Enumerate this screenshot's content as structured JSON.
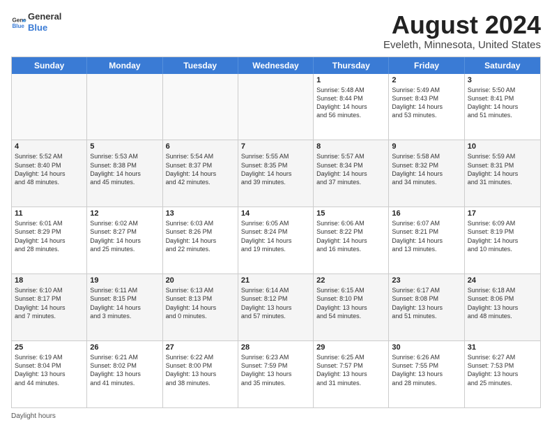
{
  "header": {
    "logo_line1": "General",
    "logo_line2": "Blue",
    "main_title": "August 2024",
    "subtitle": "Eveleth, Minnesota, United States"
  },
  "days_of_week": [
    "Sunday",
    "Monday",
    "Tuesday",
    "Wednesday",
    "Thursday",
    "Friday",
    "Saturday"
  ],
  "footer_text": "Daylight hours",
  "rows": [
    [
      {
        "day": "",
        "info": "",
        "empty": true
      },
      {
        "day": "",
        "info": "",
        "empty": true
      },
      {
        "day": "",
        "info": "",
        "empty": true
      },
      {
        "day": "",
        "info": "",
        "empty": true
      },
      {
        "day": "1",
        "info": "Sunrise: 5:48 AM\nSunset: 8:44 PM\nDaylight: 14 hours\nand 56 minutes.",
        "empty": false
      },
      {
        "day": "2",
        "info": "Sunrise: 5:49 AM\nSunset: 8:43 PM\nDaylight: 14 hours\nand 53 minutes.",
        "empty": false
      },
      {
        "day": "3",
        "info": "Sunrise: 5:50 AM\nSunset: 8:41 PM\nDaylight: 14 hours\nand 51 minutes.",
        "empty": false
      }
    ],
    [
      {
        "day": "4",
        "info": "Sunrise: 5:52 AM\nSunset: 8:40 PM\nDaylight: 14 hours\nand 48 minutes.",
        "empty": false,
        "alt": true
      },
      {
        "day": "5",
        "info": "Sunrise: 5:53 AM\nSunset: 8:38 PM\nDaylight: 14 hours\nand 45 minutes.",
        "empty": false,
        "alt": true
      },
      {
        "day": "6",
        "info": "Sunrise: 5:54 AM\nSunset: 8:37 PM\nDaylight: 14 hours\nand 42 minutes.",
        "empty": false,
        "alt": true
      },
      {
        "day": "7",
        "info": "Sunrise: 5:55 AM\nSunset: 8:35 PM\nDaylight: 14 hours\nand 39 minutes.",
        "empty": false,
        "alt": true
      },
      {
        "day": "8",
        "info": "Sunrise: 5:57 AM\nSunset: 8:34 PM\nDaylight: 14 hours\nand 37 minutes.",
        "empty": false,
        "alt": true
      },
      {
        "day": "9",
        "info": "Sunrise: 5:58 AM\nSunset: 8:32 PM\nDaylight: 14 hours\nand 34 minutes.",
        "empty": false,
        "alt": true
      },
      {
        "day": "10",
        "info": "Sunrise: 5:59 AM\nSunset: 8:31 PM\nDaylight: 14 hours\nand 31 minutes.",
        "empty": false,
        "alt": true
      }
    ],
    [
      {
        "day": "11",
        "info": "Sunrise: 6:01 AM\nSunset: 8:29 PM\nDaylight: 14 hours\nand 28 minutes.",
        "empty": false
      },
      {
        "day": "12",
        "info": "Sunrise: 6:02 AM\nSunset: 8:27 PM\nDaylight: 14 hours\nand 25 minutes.",
        "empty": false
      },
      {
        "day": "13",
        "info": "Sunrise: 6:03 AM\nSunset: 8:26 PM\nDaylight: 14 hours\nand 22 minutes.",
        "empty": false
      },
      {
        "day": "14",
        "info": "Sunrise: 6:05 AM\nSunset: 8:24 PM\nDaylight: 14 hours\nand 19 minutes.",
        "empty": false
      },
      {
        "day": "15",
        "info": "Sunrise: 6:06 AM\nSunset: 8:22 PM\nDaylight: 14 hours\nand 16 minutes.",
        "empty": false
      },
      {
        "day": "16",
        "info": "Sunrise: 6:07 AM\nSunset: 8:21 PM\nDaylight: 14 hours\nand 13 minutes.",
        "empty": false
      },
      {
        "day": "17",
        "info": "Sunrise: 6:09 AM\nSunset: 8:19 PM\nDaylight: 14 hours\nand 10 minutes.",
        "empty": false
      }
    ],
    [
      {
        "day": "18",
        "info": "Sunrise: 6:10 AM\nSunset: 8:17 PM\nDaylight: 14 hours\nand 7 minutes.",
        "empty": false,
        "alt": true
      },
      {
        "day": "19",
        "info": "Sunrise: 6:11 AM\nSunset: 8:15 PM\nDaylight: 14 hours\nand 3 minutes.",
        "empty": false,
        "alt": true
      },
      {
        "day": "20",
        "info": "Sunrise: 6:13 AM\nSunset: 8:13 PM\nDaylight: 14 hours\nand 0 minutes.",
        "empty": false,
        "alt": true
      },
      {
        "day": "21",
        "info": "Sunrise: 6:14 AM\nSunset: 8:12 PM\nDaylight: 13 hours\nand 57 minutes.",
        "empty": false,
        "alt": true
      },
      {
        "day": "22",
        "info": "Sunrise: 6:15 AM\nSunset: 8:10 PM\nDaylight: 13 hours\nand 54 minutes.",
        "empty": false,
        "alt": true
      },
      {
        "day": "23",
        "info": "Sunrise: 6:17 AM\nSunset: 8:08 PM\nDaylight: 13 hours\nand 51 minutes.",
        "empty": false,
        "alt": true
      },
      {
        "day": "24",
        "info": "Sunrise: 6:18 AM\nSunset: 8:06 PM\nDaylight: 13 hours\nand 48 minutes.",
        "empty": false,
        "alt": true
      }
    ],
    [
      {
        "day": "25",
        "info": "Sunrise: 6:19 AM\nSunset: 8:04 PM\nDaylight: 13 hours\nand 44 minutes.",
        "empty": false
      },
      {
        "day": "26",
        "info": "Sunrise: 6:21 AM\nSunset: 8:02 PM\nDaylight: 13 hours\nand 41 minutes.",
        "empty": false
      },
      {
        "day": "27",
        "info": "Sunrise: 6:22 AM\nSunset: 8:00 PM\nDaylight: 13 hours\nand 38 minutes.",
        "empty": false
      },
      {
        "day": "28",
        "info": "Sunrise: 6:23 AM\nSunset: 7:59 PM\nDaylight: 13 hours\nand 35 minutes.",
        "empty": false
      },
      {
        "day": "29",
        "info": "Sunrise: 6:25 AM\nSunset: 7:57 PM\nDaylight: 13 hours\nand 31 minutes.",
        "empty": false
      },
      {
        "day": "30",
        "info": "Sunrise: 6:26 AM\nSunset: 7:55 PM\nDaylight: 13 hours\nand 28 minutes.",
        "empty": false
      },
      {
        "day": "31",
        "info": "Sunrise: 6:27 AM\nSunset: 7:53 PM\nDaylight: 13 hours\nand 25 minutes.",
        "empty": false
      }
    ]
  ]
}
